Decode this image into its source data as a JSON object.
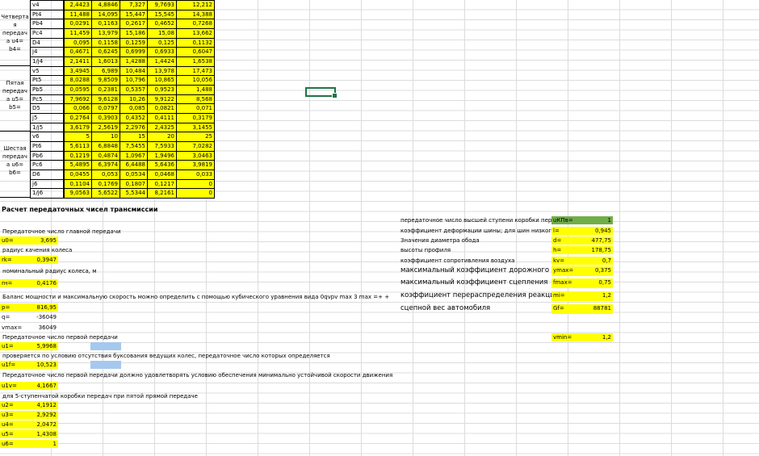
{
  "top_table": {
    "groups": [
      {
        "name": "Четверта\nя\nпередач\nа u4=\nb4=",
        "rows": [
          {
            "label": "v4",
            "values": [
              "2,4423",
              "4,8846",
              "7,327",
              "9,7693",
              "12,212"
            ]
          },
          {
            "label": "Pt4",
            "values": [
              "11,488",
              "14,095",
              "15,447",
              "15,545",
              "14,388"
            ]
          },
          {
            "label": "Pb4",
            "values": [
              "0,0291",
              "0,1163",
              "0,2617",
              "0,4652",
              "0,7268"
            ]
          },
          {
            "label": "Pc4",
            "values": [
              "11,459",
              "13,979",
              "15,186",
              "15,08",
              "13,662"
            ]
          },
          {
            "label": "D4",
            "values": [
              "0,095",
              "0,1158",
              "0,1259",
              "0,125",
              "0,1132"
            ]
          },
          {
            "label": "j4",
            "values": [
              "0,4671",
              "0,6245",
              "0,6999",
              "0,6933",
              "0,6047"
            ]
          },
          {
            "label": "1/j4",
            "values": [
              "2,1411",
              "1,6013",
              "1,4288",
              "1,4424",
              "1,6538"
            ]
          }
        ]
      },
      {
        "name": "Пятая\nпередач\nа u5=\nb5=",
        "rows": [
          {
            "label": "v5",
            "values": [
              "3,4945",
              "6,989",
              "10,484",
              "13,978",
              "17,473"
            ]
          },
          {
            "label": "Pt5",
            "values": [
              "8,0288",
              "9,8509",
              "10,796",
              "10,865",
              "10,056"
            ]
          },
          {
            "label": "Pb5",
            "values": [
              "0,0595",
              "0,2381",
              "0,5357",
              "0,9523",
              "1,488"
            ]
          },
          {
            "label": "Pc5",
            "values": [
              "7,9692",
              "9,6128",
              "10,26",
              "9,9122",
              "8,568"
            ]
          },
          {
            "label": "D5",
            "values": [
              "0,066",
              "0,0797",
              "0,085",
              "0,0821",
              "0,071"
            ]
          },
          {
            "label": "j5",
            "values": [
              "0,2764",
              "0,3903",
              "0,4352",
              "0,4111",
              "0,3179"
            ]
          },
          {
            "label": "1/j5",
            "values": [
              "3,6179",
              "2,5619",
              "2,2976",
              "2,4325",
              "3,1455"
            ]
          }
        ]
      },
      {
        "name": "Шестая\nпередач\nа u6=\nb6=",
        "rows": [
          {
            "label": "v6",
            "values": [
              "5",
              "10",
              "15",
              "20",
              "25"
            ]
          },
          {
            "label": "Pt6",
            "values": [
              "5,6113",
              "6,8848",
              "7,5455",
              "7,5933",
              "7,0282"
            ]
          },
          {
            "label": "Pb6",
            "values": [
              "0,1219",
              "0,4874",
              "1,0967",
              "1,9496",
              "3,0463"
            ]
          },
          {
            "label": "Pc6",
            "values": [
              "5,4895",
              "6,3974",
              "6,4488",
              "5,6436",
              "3,9819"
            ]
          },
          {
            "label": "D6",
            "values": [
              "0,0455",
              "0,053",
              "0,0534",
              "0,0468",
              "0,033"
            ]
          },
          {
            "label": "j6",
            "values": [
              "0,1104",
              "0,1769",
              "0,1807",
              "0,1217",
              "0"
            ]
          },
          {
            "label": "1/j6",
            "values": [
              "9,0563",
              "5,6522",
              "5,5344",
              "8,2161",
              "0"
            ]
          }
        ]
      }
    ]
  },
  "section_title": "Расчет передаточных чисел трансмиссии",
  "left_block": {
    "l1": "Передаточное число главной передачи",
    "u0_label": "u0=",
    "u0_value": "3,695",
    "l2": "радиус качения колеса",
    "rk_label": "rk=",
    "rk_value": "0,3947",
    "l3": "номинальный радиус колеса, м",
    "rn_label": "rн=",
    "rn_value": "0,4176",
    "l4": "Баланс мощности и максимальную скорость можно определить с помощью кубического уравнения вида 0qvpv max 3 max =+ +",
    "p_label": "p=",
    "p_value": "816,95",
    "q_label": "q=",
    "q_value": "-36049",
    "vmax_label": "vmax=",
    "vmax_value": "36049",
    "l5": "Передаточное число первой передачи",
    "u1_label": "u1=",
    "u1_value": "5,9968",
    "l6": "проверяется по условию отсутствия буксования ведущих колес, передаточное число которых определяется",
    "u1f_label": "u1f=",
    "u1f_value": "10,523",
    "l7": "Передаточное число первой передачи должно удовлетворять условию обеспечения минимально устойчивой скорости движения",
    "u1v_label": "u1v=",
    "u1v_value": "4,1667",
    "l8": "для 5-ступенчатой коробки передач при пятой прямой передаче",
    "gears": [
      {
        "label": "u2=",
        "value": "4,1912"
      },
      {
        "label": "u3=",
        "value": "2,9292"
      },
      {
        "label": "u4=",
        "value": "2,0472"
      },
      {
        "label": "u5=",
        "value": "1,4308"
      },
      {
        "label": "u6=",
        "value": "1"
      }
    ]
  },
  "right_block": {
    "rows": [
      {
        "desc": "передаточное число высшей ступени коробки передач",
        "label": "uКПв=",
        "value": "1"
      },
      {
        "desc": "коэффициент деформации шины; для шин низкого давления",
        "label": "l=",
        "value": "0,945"
      },
      {
        "desc": "Значения диаметра обода",
        "label": "d=",
        "value": "477,75"
      },
      {
        "desc": "высоты профиля",
        "label": "h=",
        "value": "178,75"
      },
      {
        "desc": "коэффициент сопротивления воздуха",
        "label": "kv=",
        "value": "0,7"
      },
      {
        "desc": "максимальный коэффициент дорожного сопротивления",
        "label": "ymax=",
        "value": "0,375"
      },
      {
        "desc": "максимальный коэффициент сцепления",
        "label": "fmax=",
        "value": "0,75"
      },
      {
        "desc": "коэффициент перераспределения реакций",
        "label": "mi=",
        "value": "1,2"
      },
      {
        "desc": "сцепной вес автомобиля",
        "label": "Gf=",
        "value": "88781"
      }
    ],
    "vmin_label": "vmin=",
    "vmin_value": "1,2"
  }
}
